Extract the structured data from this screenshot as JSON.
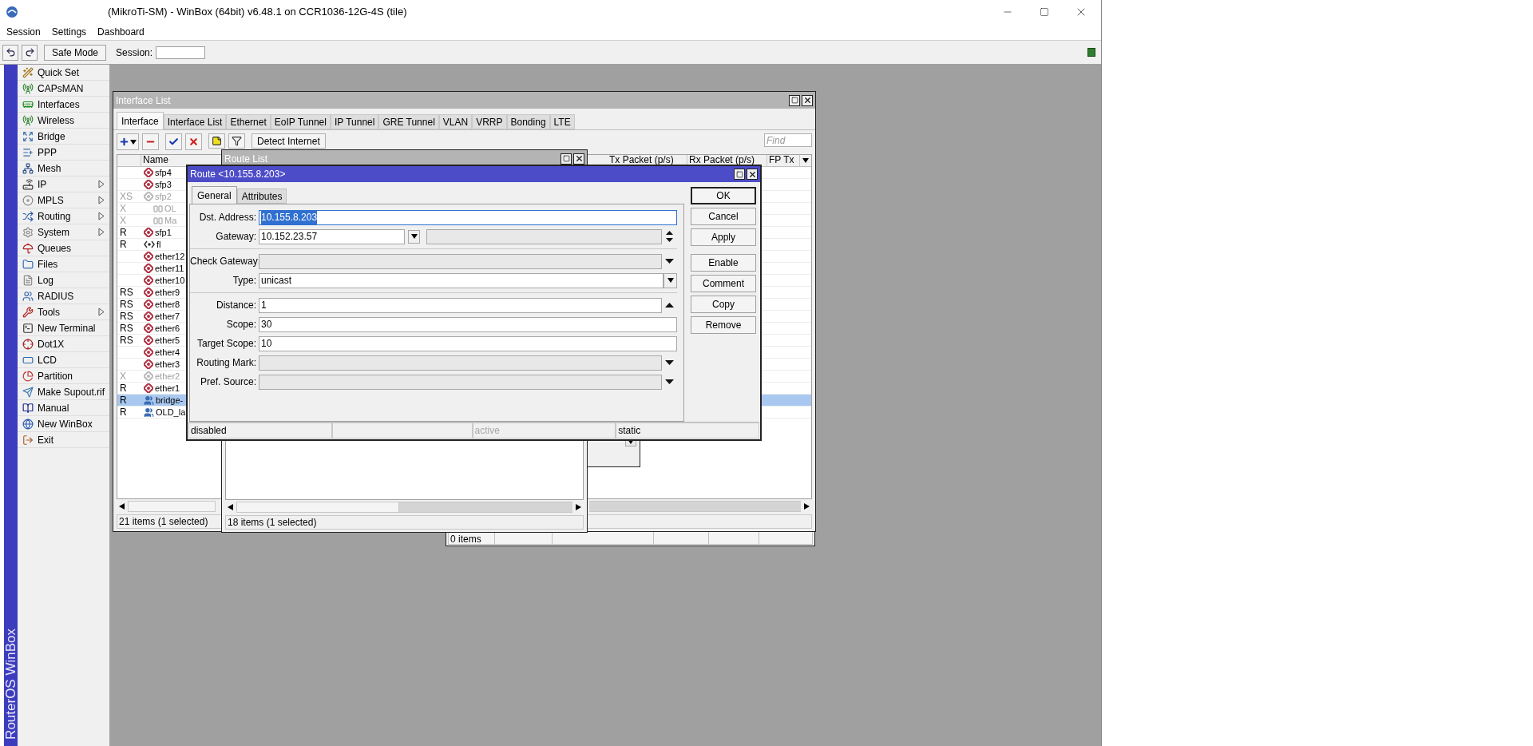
{
  "window": {
    "title": "(MikroTi-SM) - WinBox (64bit) v6.48.1 on CCR1036-12G-4S (tile)"
  },
  "menu": [
    "Session",
    "Settings",
    "Dashboard"
  ],
  "toolbar": {
    "safe_mode": "Safe Mode",
    "session_label": "Session:"
  },
  "sidebar": {
    "brand": "RouterOS WinBox",
    "items": [
      {
        "label": "Quick Set",
        "submenu": false
      },
      {
        "label": "CAPsMAN",
        "submenu": false
      },
      {
        "label": "Interfaces",
        "submenu": false
      },
      {
        "label": "Wireless",
        "submenu": false
      },
      {
        "label": "Bridge",
        "submenu": false
      },
      {
        "label": "PPP",
        "submenu": false
      },
      {
        "label": "Mesh",
        "submenu": false
      },
      {
        "label": "IP",
        "submenu": true
      },
      {
        "label": "MPLS",
        "submenu": true
      },
      {
        "label": "Routing",
        "submenu": true
      },
      {
        "label": "System",
        "submenu": true
      },
      {
        "label": "Queues",
        "submenu": false
      },
      {
        "label": "Files",
        "submenu": false
      },
      {
        "label": "Log",
        "submenu": false
      },
      {
        "label": "RADIUS",
        "submenu": false
      },
      {
        "label": "Tools",
        "submenu": true
      },
      {
        "label": "New Terminal",
        "submenu": false
      },
      {
        "label": "Dot1X",
        "submenu": false
      },
      {
        "label": "LCD",
        "submenu": false
      },
      {
        "label": "Partition",
        "submenu": false
      },
      {
        "label": "Make Supout.rif",
        "submenu": false
      },
      {
        "label": "Manual",
        "submenu": false
      },
      {
        "label": "New WinBox",
        "submenu": false
      },
      {
        "label": "Exit",
        "submenu": false
      }
    ]
  },
  "interface_list": {
    "title": "Interface List",
    "tabs": [
      {
        "label": "Interface",
        "selected": true
      },
      {
        "label": "Interface List",
        "selected": false
      },
      {
        "label": "Ethernet",
        "selected": false
      },
      {
        "label": "EoIP Tunnel",
        "selected": false
      },
      {
        "label": "IP Tunnel",
        "selected": false
      },
      {
        "label": "GRE Tunnel",
        "selected": false
      },
      {
        "label": "VLAN",
        "selected": false
      },
      {
        "label": "VRRP",
        "selected": false
      },
      {
        "label": "Bonding",
        "selected": false
      },
      {
        "label": "LTE",
        "selected": false
      }
    ],
    "detect_button": "Detect Internet",
    "find_placeholder": "Find",
    "columns": [
      "Name",
      "Tx Packet (p/s)",
      "Rx Packet (p/s)",
      "FP Tx"
    ],
    "rows": [
      {
        "name": "sfp4",
        "kind": "ethernet",
        "disabled": false,
        "selected": false
      },
      {
        "name": "sfp3",
        "kind": "ethernet",
        "disabled": false,
        "selected": false
      },
      {
        "flags": "XS",
        "name": "sfp2",
        "kind": "ethernet",
        "disabled": true,
        "selected": false
      },
      {
        "flags": "X",
        "name": "OL",
        "kind": "slave",
        "disabled": true,
        "selected": false
      },
      {
        "flags": "X",
        "name": "Ma",
        "kind": "slave",
        "disabled": true,
        "selected": false
      },
      {
        "flags": "R",
        "name": "sfp1",
        "kind": "ethernet",
        "disabled": false,
        "selected": false
      },
      {
        "flags": "R",
        "name": "fl",
        "kind": "bonding",
        "disabled": false,
        "selected": false
      },
      {
        "name": "ether12",
        "kind": "ethernet",
        "disabled": false,
        "selected": false
      },
      {
        "name": "ether11",
        "kind": "ethernet",
        "disabled": false,
        "selected": false
      },
      {
        "name": "ether10",
        "kind": "ethernet",
        "disabled": false,
        "selected": false
      },
      {
        "flags": "RS",
        "name": "ether9",
        "kind": "ethernet",
        "disabled": false,
        "selected": false
      },
      {
        "flags": "RS",
        "name": "ether8",
        "kind": "ethernet",
        "disabled": false,
        "selected": false
      },
      {
        "flags": "RS",
        "name": "ether7",
        "kind": "ethernet",
        "disabled": false,
        "selected": false
      },
      {
        "flags": "RS",
        "name": "ether6",
        "kind": "ethernet",
        "disabled": false,
        "selected": false
      },
      {
        "flags": "RS",
        "name": "ether5",
        "kind": "ethernet",
        "disabled": false,
        "selected": false
      },
      {
        "name": "ether4",
        "kind": "ethernet",
        "disabled": false,
        "selected": false
      },
      {
        "name": "ether3",
        "kind": "ethernet",
        "disabled": false,
        "selected": false
      },
      {
        "flags": "X",
        "name": "ether2",
        "kind": "ethernet",
        "disabled": true,
        "selected": false
      },
      {
        "flags": "R",
        "name": "ether1",
        "kind": "ethernet",
        "disabled": false,
        "selected": false
      },
      {
        "flags": "R",
        "name": "bridge-",
        "kind": "bridge",
        "disabled": false,
        "selected": true
      },
      {
        "flags": "R",
        "name": "OLD_la",
        "kind": "bridge",
        "disabled": false,
        "selected": false
      }
    ],
    "status": "21 items (1 selected)"
  },
  "other_window": {
    "status": "0 items"
  },
  "route_list": {
    "title": "Route List",
    "status": "18 items (1 selected)"
  },
  "route": {
    "title": "Route <10.155.8.203>",
    "tabs": [
      {
        "label": "General",
        "selected": true
      },
      {
        "label": "Attributes",
        "selected": false
      }
    ],
    "field_groups": [
      [
        {
          "label": "Dst. Address:",
          "value": "10.155.8.203",
          "kind": "text",
          "selected": true
        },
        {
          "label": "Gateway:",
          "value": "10.152.23.57",
          "kind": "gateway",
          "selected": false
        }
      ],
      [
        {
          "label": "Check Gateway:",
          "kind": "dropdown",
          "selected": false
        },
        {
          "label": "Type:",
          "value": "unicast",
          "kind": "combo",
          "selected": false
        }
      ],
      [
        {
          "label": "Distance:",
          "value": "1",
          "kind": "number",
          "selected": false
        },
        {
          "label": "Scope:",
          "value": "30",
          "kind": "text",
          "selected": false
        },
        {
          "label": "Target Scope:",
          "value": "10",
          "kind": "text",
          "selected": false
        },
        {
          "label": "Routing Mark:",
          "kind": "dropdown",
          "selected": false
        },
        {
          "label": "Pref. Source:",
          "kind": "dropdown",
          "selected": false
        }
      ]
    ],
    "button_groups": [
      [
        {
          "label": "OK",
          "default": true
        },
        {
          "label": "Cancel",
          "default": false
        },
        {
          "label": "Apply",
          "default": false
        }
      ],
      [
        {
          "label": "Enable",
          "default": false
        },
        {
          "label": "Comment",
          "default": false
        },
        {
          "label": "Copy",
          "default": false
        },
        {
          "label": "Remove",
          "default": false
        }
      ]
    ],
    "status_bar": [
      {
        "kind": "text",
        "text": "disabled",
        "dimmed": false
      },
      {
        "kind": "empty"
      },
      {
        "kind": "text",
        "text": "active",
        "dimmed": true
      },
      {
        "kind": "text",
        "text": "static",
        "dimmed": false
      }
    ]
  }
}
